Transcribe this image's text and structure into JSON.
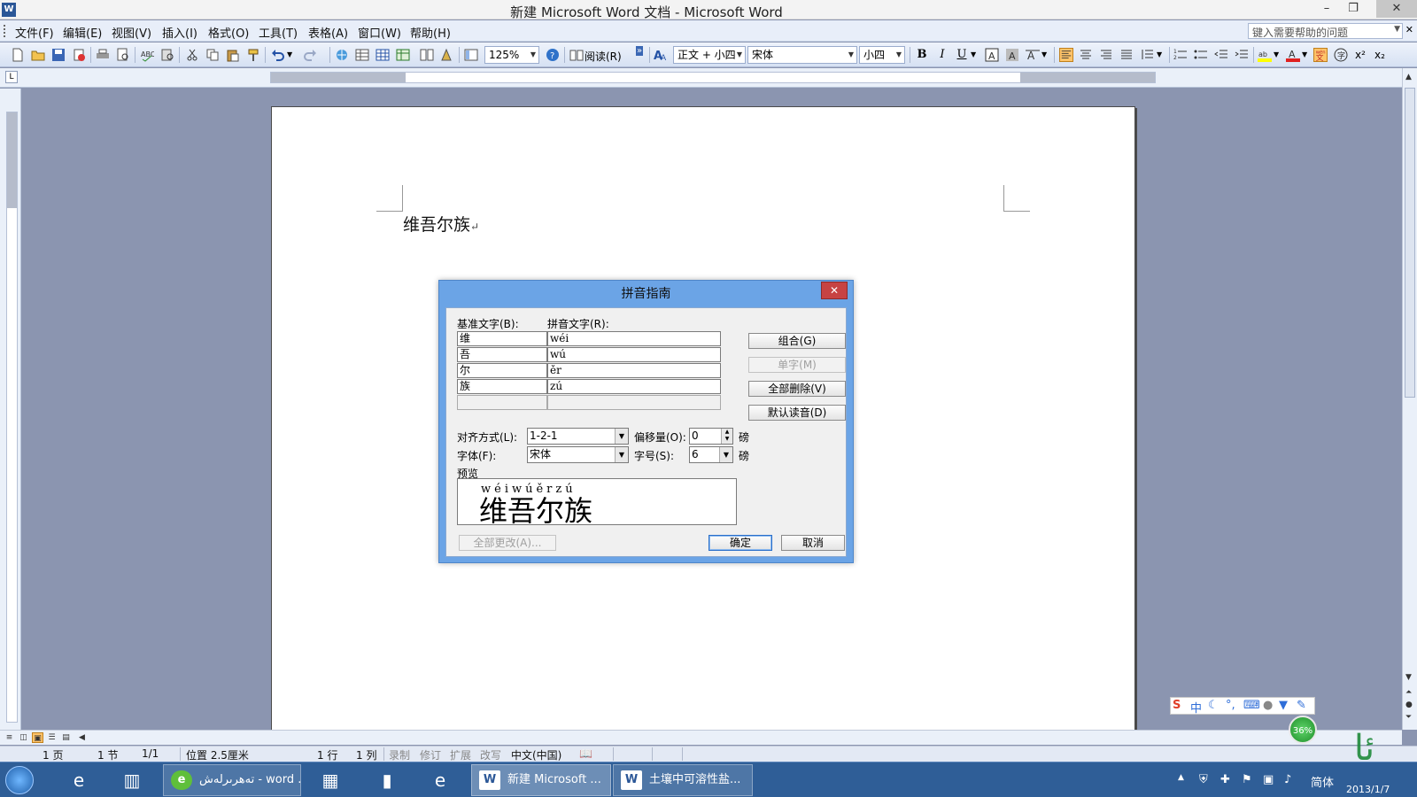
{
  "window": {
    "title": "新建 Microsoft Word 文档 - Microsoft Word",
    "minimize": "–",
    "maximize": "❐",
    "close": "✕"
  },
  "menu": {
    "items": [
      "文件(F)",
      "编辑(E)",
      "视图(V)",
      "插入(I)",
      "格式(O)",
      "工具(T)",
      "表格(A)",
      "窗口(W)",
      "帮助(H)"
    ],
    "help_placeholder": "键入需要帮助的问题"
  },
  "toolbar": {
    "zoom": "125%",
    "read_label": "阅读(R)",
    "style": "正文 + 小四",
    "font": "宋体",
    "size": "小四",
    "bold": "B",
    "italic": "I",
    "underline": "U"
  },
  "document": {
    "text": "维吾尔族",
    "para_mark": "↵"
  },
  "dialog": {
    "title": "拼音指南",
    "base_label": "基准文字(B):",
    "ruby_label": "拼音文字(R):",
    "rows": [
      {
        "base": "维",
        "ruby": "wéi"
      },
      {
        "base": "吾",
        "ruby": "wú"
      },
      {
        "base": "尔",
        "ruby": "ěr"
      },
      {
        "base": "族",
        "ruby": "zú"
      }
    ],
    "buttons": {
      "combine": "组合(G)",
      "single": "单字(M)",
      "clear_all": "全部删除(V)",
      "default_reading": "默认读音(D)",
      "change_all": "全部更改(A)...",
      "ok": "确定",
      "cancel": "取消"
    },
    "alignment_label": "对齐方式(L):",
    "alignment_value": "1-2-1",
    "offset_label": "偏移量(O):",
    "offset_value": "0",
    "offset_unit": "磅",
    "font_label": "字体(F):",
    "font_value": "宋体",
    "size_label": "字号(S):",
    "size_value": "6",
    "size_unit": "磅",
    "preview_label": "预览",
    "preview_pinyin": "wéiwúěrzú",
    "preview_text": "维吾尔族"
  },
  "statusbar": {
    "page": "1 页",
    "section": "1 节",
    "pages": "1/1",
    "position": "位置 2.5厘米",
    "line": "1 行",
    "column": "1 列",
    "rec": "录制",
    "trk": "修订",
    "ext": "扩展",
    "ovr": "改写",
    "language": "中文(中国)"
  },
  "taskbar": {
    "tasks": [
      {
        "label": "تەھرىرلەش - word ..."
      },
      {
        "label": "新建 Microsoft ..."
      },
      {
        "label": "土壤中可溶性盐..."
      }
    ],
    "ime_lang": "简体",
    "clock": "2013/1/7"
  },
  "ime": {
    "mode": "中"
  },
  "net": {
    "percent": "36%"
  }
}
